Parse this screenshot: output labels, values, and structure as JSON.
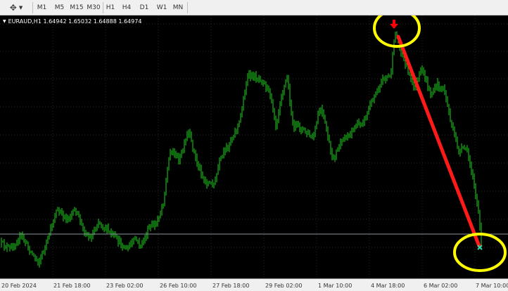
{
  "toolbar": {
    "tool_icon": "drawing-tools-icon",
    "timeframes": [
      "M1",
      "M5",
      "M15",
      "M30",
      "H1",
      "H4",
      "D1",
      "W1",
      "MN"
    ]
  },
  "chart": {
    "legend": "EURAUD,H1  1.64942 1.65032 1.64888 1.64974",
    "x_ticks": [
      "20 Feb 2024",
      "21 Feb 18:00",
      "23 Feb 02:00",
      "26 Feb 10:00",
      "27 Feb 18:00",
      "29 Feb 02:00",
      "1 Mar 10:00",
      "4 Mar 18:00",
      "6 Mar 02:00",
      "7 Mar 10:00"
    ],
    "colors": {
      "background": "#000000",
      "candles": "#1ed41e",
      "grid": "#2a2a2a",
      "price_line": "#8c96a0",
      "trend_line": "#ff1a1a",
      "circle": "#ffff00",
      "sell_arrow": "#ff0000",
      "close_marker": "#2ed8a8"
    },
    "icons": {
      "sell_arrow": "sell-arrow-icon",
      "close_marker": "close-x-icon"
    },
    "chart_data": {
      "type": "candlestick",
      "symbol": "EURAUD",
      "timeframe": "H1",
      "ohlc": [
        1.64942,
        1.65032,
        1.64888,
        1.64974
      ],
      "x": [
        "20 Feb 2024",
        "21 Feb 18:00",
        "23 Feb 02:00",
        "26 Feb 10:00",
        "27 Feb 18:00",
        "29 Feb 02:00",
        "1 Mar 10:00",
        "4 Mar 18:00",
        "6 Mar 02:00",
        "7 Mar 10:00"
      ],
      "grid": true
    }
  }
}
